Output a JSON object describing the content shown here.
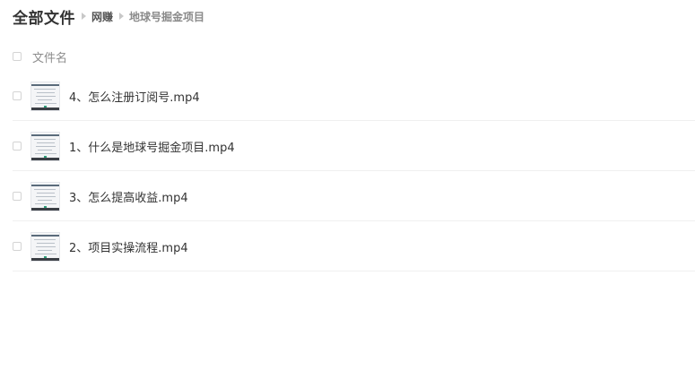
{
  "breadcrumb": {
    "root": "全部文件",
    "middle": "网赚",
    "current": "地球号掘金项目"
  },
  "list_header": {
    "column_label": "文件名"
  },
  "files": [
    {
      "name": "4、怎么注册订阅号.mp4",
      "icon": "video-thumbnail-icon"
    },
    {
      "name": "1、什么是地球号掘金项目.mp4",
      "icon": "video-thumbnail-icon"
    },
    {
      "name": "3、怎么提高收益.mp4",
      "icon": "video-thumbnail-icon"
    },
    {
      "name": "2、项目实操流程.mp4",
      "icon": "video-thumbnail-icon"
    }
  ],
  "colors": {
    "text_primary": "#333333",
    "text_muted": "#8c8c8c",
    "divider": "#f0f0f0",
    "checkbox_border": "#d4d4d4"
  }
}
